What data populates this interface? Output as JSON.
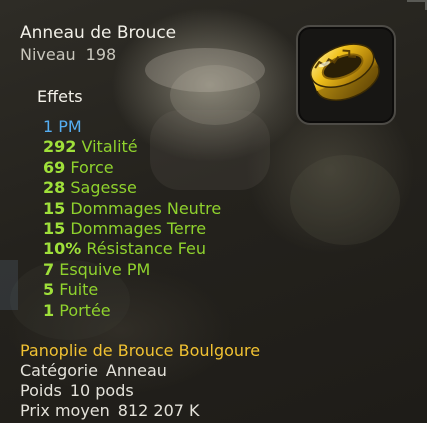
{
  "item": {
    "name": "Anneau de Brouce",
    "level_label": "Niveau",
    "level_value": "198"
  },
  "effects": {
    "heading": "Effets",
    "list": [
      {
        "value": "1",
        "label": "PM",
        "color": "#55aef2"
      },
      {
        "value": "292",
        "label": "Vitalité",
        "color": "#8fd22d"
      },
      {
        "value": "69",
        "label": "Force",
        "color": "#8fd22d"
      },
      {
        "value": "28",
        "label": "Sagesse",
        "color": "#8fd22d"
      },
      {
        "value": "15",
        "label": "Dommages Neutre",
        "color": "#8fd22d"
      },
      {
        "value": "15",
        "label": "Dommages Terre",
        "color": "#8fd22d"
      },
      {
        "value": "10%",
        "label": "Résistance Feu",
        "color": "#8fd22d"
      },
      {
        "value": "7",
        "label": "Esquive PM",
        "color": "#8fd22d"
      },
      {
        "value": "5",
        "label": "Fuite",
        "color": "#8fd22d"
      },
      {
        "value": "1",
        "label": "Portée",
        "color": "#8fd22d"
      }
    ]
  },
  "set_name": "Panoplie de Brouce Boulgoure",
  "details": {
    "category_label": "Catégorie",
    "category_value": "Anneau",
    "weight_label": "Poids",
    "weight_value": "10 pods",
    "price_label": "Prix moyen",
    "price_value": "812 207 K"
  },
  "icon": {
    "name": "gold-ring-icon",
    "color": "#e2b41c"
  },
  "colors": {
    "set": "#f1c232",
    "effect_positive": "#8fd22d",
    "effect_movement": "#55aef2"
  }
}
